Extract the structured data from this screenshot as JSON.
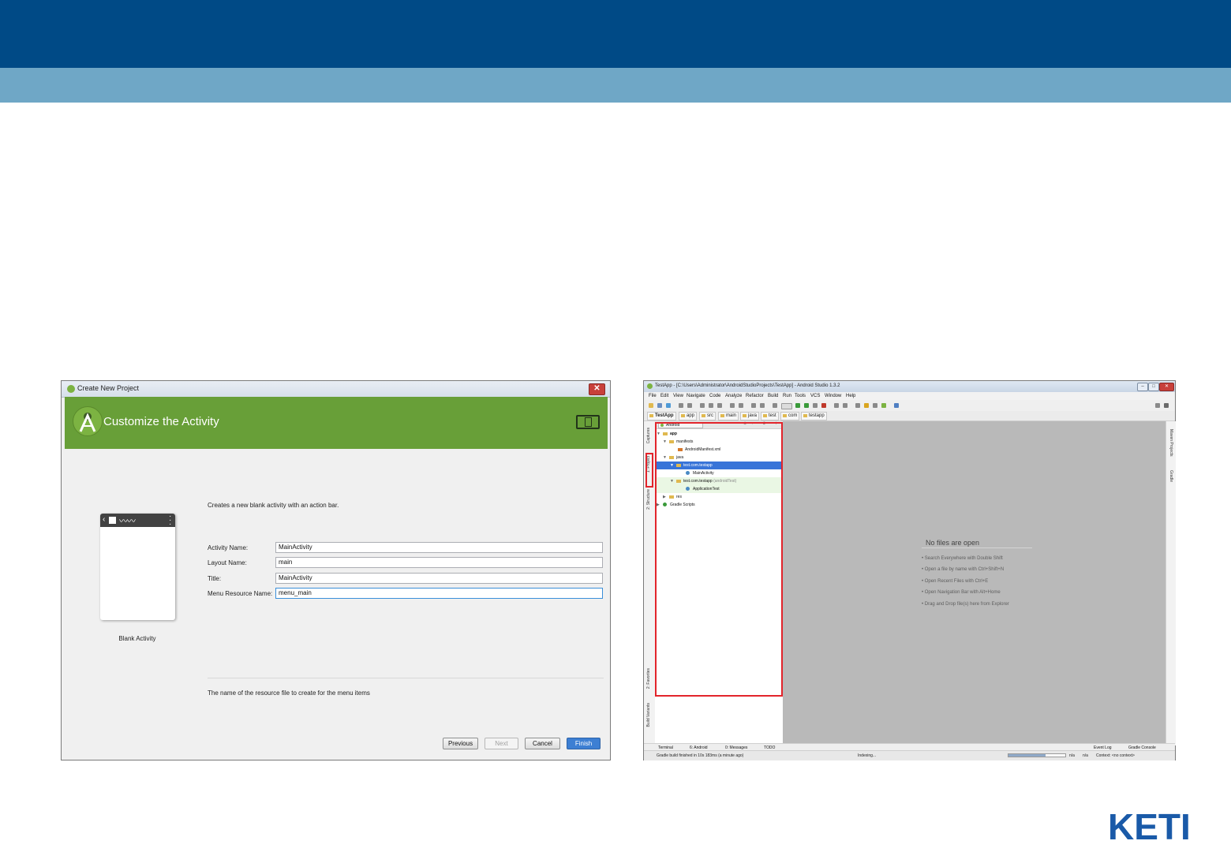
{
  "slide": {
    "header_color": "#004a86",
    "subheader_color": "#6fa7c6"
  },
  "create_project": {
    "window_title": "Create New Project",
    "close_glyph": "✕",
    "heading": "Customize the Activity",
    "banner_color": "#689f38",
    "template_label": "Blank Activity",
    "description": "Creates a new blank activity with an action bar.",
    "fields": [
      {
        "label": "Activity Name:",
        "value": "MainActivity"
      },
      {
        "label": "Layout Name:",
        "value": "main"
      },
      {
        "label": "Title:",
        "value": "MainActivity"
      },
      {
        "label": "Menu Resource Name:",
        "value": "menu_main"
      }
    ],
    "hint": "The name of the resource file to create for the menu items",
    "buttons": {
      "previous": "Previous",
      "next": "Next",
      "cancel": "Cancel",
      "finish": "Finish"
    }
  },
  "studio": {
    "window_title": "TestApp - [C:\\Users\\Administrator\\AndroidStudioProjects\\TestApp] - Android Studio 1.3.2",
    "controls": {
      "minimize": "–",
      "maximize": "□",
      "close": "✕"
    },
    "menu": [
      "File",
      "Edit",
      "View",
      "Navigate",
      "Code",
      "Analyze",
      "Refactor",
      "Build",
      "Run",
      "Tools",
      "VCS",
      "Window",
      "Help"
    ],
    "breadcrumbs": [
      "TestApp",
      "app",
      "src",
      "main",
      "java",
      "test",
      "com",
      "testapp"
    ],
    "left_tabs": [
      "Captures",
      "1: Project",
      "2: Structure",
      "2: Favorites",
      "Build Variants"
    ],
    "right_tabs": [
      "Maven Projects",
      "Gradle"
    ],
    "project_view": "Android",
    "tree": [
      {
        "label": "app"
      },
      {
        "label": "manifests"
      },
      {
        "label": "AndroidManifest.xml"
      },
      {
        "label": "java"
      },
      {
        "label": "test.com.testapp"
      },
      {
        "label": "MainActivity"
      },
      {
        "label": "test.com.testapp",
        "suffix": "(androidTest)"
      },
      {
        "label": "ApplicationTest"
      },
      {
        "label": "res"
      },
      {
        "label": "Gradle Scripts"
      }
    ],
    "editor": {
      "no_files": "No files are open",
      "tips": [
        "• Search Everywhere with Double Shift",
        "• Open a file by name with Ctrl+Shift+N",
        "• Open Recent Files with Ctrl+E",
        "• Open Navigation Bar with Alt+Home",
        "• Drag and Drop file(s) here from Explorer"
      ]
    },
    "bottom_tabs": [
      "Terminal",
      "6: Android",
      "0: Messages",
      "TODO"
    ],
    "bottom_right_tabs": [
      "Event Log",
      "Gradle Console"
    ],
    "status": {
      "message": "Gradle build finished in 10s 183ms (a minute ago)",
      "indexing": "Indexing...",
      "position1": "n/a",
      "position2": "n/a",
      "context": "Context: <no context>",
      "progress": 0.65
    }
  },
  "logo": {
    "text": "KETI",
    "color": "#1a5aa8"
  }
}
